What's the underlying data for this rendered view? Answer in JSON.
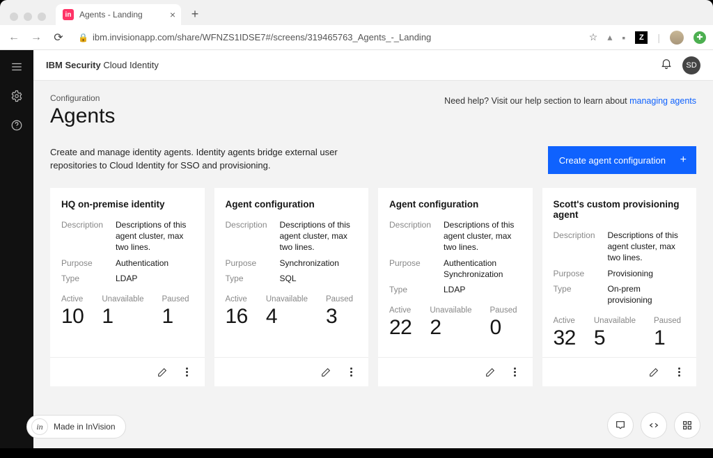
{
  "chrome": {
    "tab_title": "Agents - Landing",
    "url": "ibm.invisionapp.com/share/WFNZS1IDSE7#/screens/319465763_Agents_-_Landing",
    "ext_z": "Z"
  },
  "header": {
    "brand_strong": "IBM Security",
    "brand_light": " Cloud Identity",
    "user_initials": "SD"
  },
  "page": {
    "breadcrumb": "Configuration",
    "title": "Agents",
    "help_prefix": "Need help? Visit our help section to learn about ",
    "help_link": "managing agents",
    "lead": "Create and manage identity agents. Identity agents bridge external user repositories to Cloud Identity for SSO and provisioning.",
    "primary_button": "Create agent configuration"
  },
  "labels": {
    "description": "Description",
    "purpose": "Purpose",
    "type": "Type",
    "active": "Active",
    "unavailable": "Unavailable",
    "paused": "Paused"
  },
  "cards": [
    {
      "title": "HQ on-premise identity",
      "description": "Descriptions of this agent cluster, max two lines.",
      "purpose": "Authentication",
      "type": "LDAP",
      "active": "10",
      "unavailable": "1",
      "paused": "1"
    },
    {
      "title": "Agent configuration",
      "description": "Descriptions of this agent cluster, max two lines.",
      "purpose": "Synchronization",
      "type": "SQL",
      "active": "16",
      "unavailable": "4",
      "paused": "3"
    },
    {
      "title": "Agent configuration",
      "description": "Descriptions of this agent cluster, max two lines.",
      "purpose": "Authentication\nSynchronization",
      "type": "LDAP",
      "active": "22",
      "unavailable": "2",
      "paused": "0"
    },
    {
      "title": "Scott's custom provisioning agent",
      "description": "Descriptions of this agent cluster, max two lines.",
      "purpose": "Provisioning",
      "type": "On-prem provisioning",
      "active": "32",
      "unavailable": "5",
      "paused": "1"
    }
  ],
  "badge": {
    "text": "Made in InVision"
  }
}
